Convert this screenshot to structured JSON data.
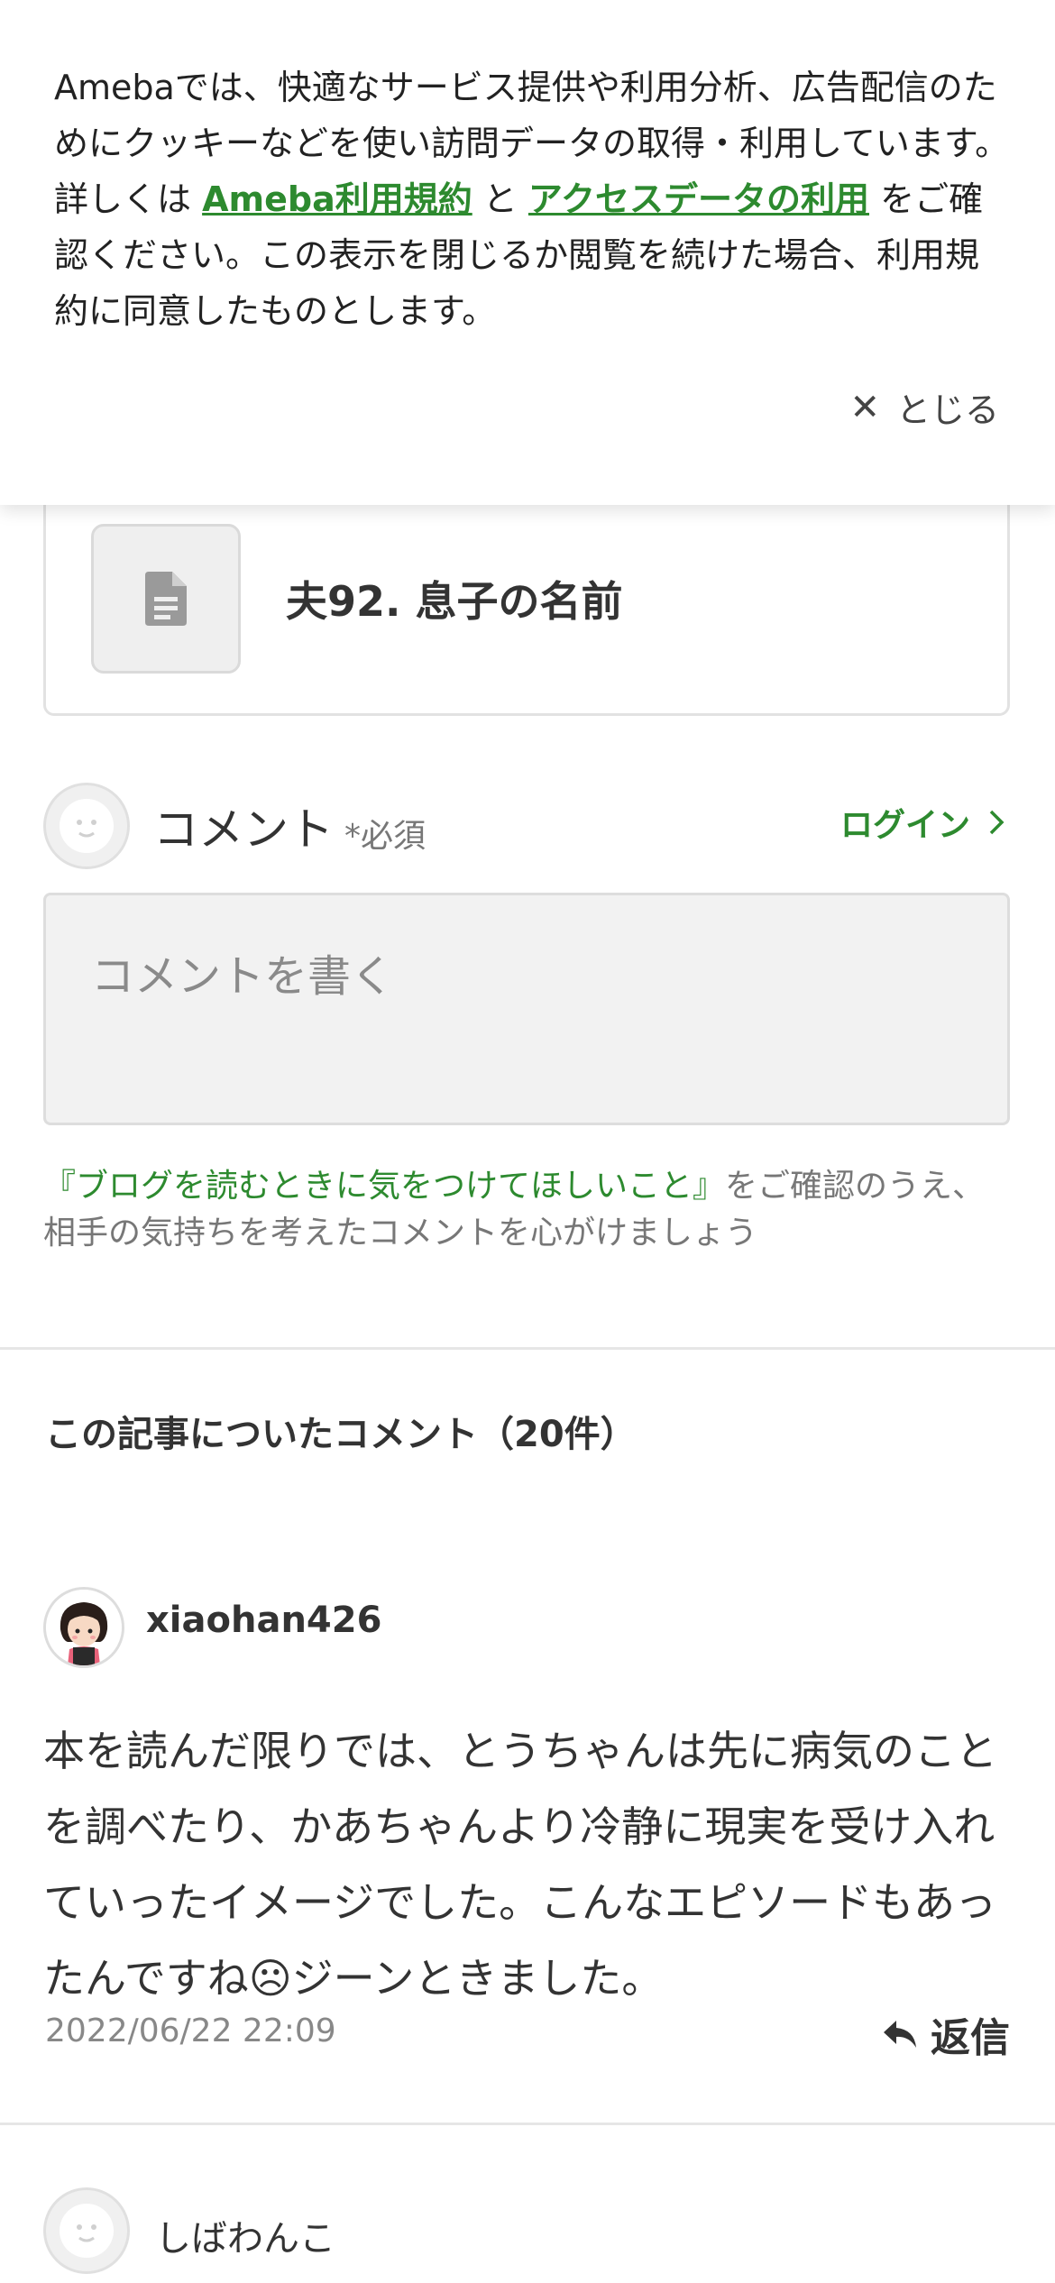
{
  "cookie_banner": {
    "text_before": "Amebaでは、快適なサービス提供や利用分析、広告配信のためにクッキーなどを使い訪問データの取得・利用しています。詳しくは ",
    "link_terms": "Ameba利用規約",
    "text_middle": " と ",
    "link_access": "アクセスデータの利用",
    "text_after": " をご確認ください。この表示を閉じるか閲覧を続けた場合、利用規約に同意したものとします。",
    "close_label": "とじる"
  },
  "related_article": {
    "title": "夫92. 息子の名前"
  },
  "comment_form": {
    "heading": "コメント",
    "required_label": "*必須",
    "login_label": "ログイン",
    "placeholder": "コメントを書く",
    "guideline_link": "『ブログを読むときに気をつけてほしいこと』",
    "guideline_text": "をご確認のうえ、相手の気持ちを考えたコメントを心がけましょう"
  },
  "comments": {
    "title": "この記事についたコメント（20件）",
    "items": [
      {
        "username": "xiaohan426",
        "body": "本を読んだ限りでは、とうちゃんは先に病気のことを調べたり、かあちゃんより冷静に現実を受け入れていったイメージでした。こんなエピソードもあったんですね☹ジーンときました。",
        "date": "2022/06/22 22:09",
        "reply_label": "返信"
      },
      {
        "username": "しばわんこ"
      }
    ]
  },
  "colors": {
    "accent_green": "#2d8a2f",
    "text_main": "#333333",
    "text_muted": "#888888"
  }
}
